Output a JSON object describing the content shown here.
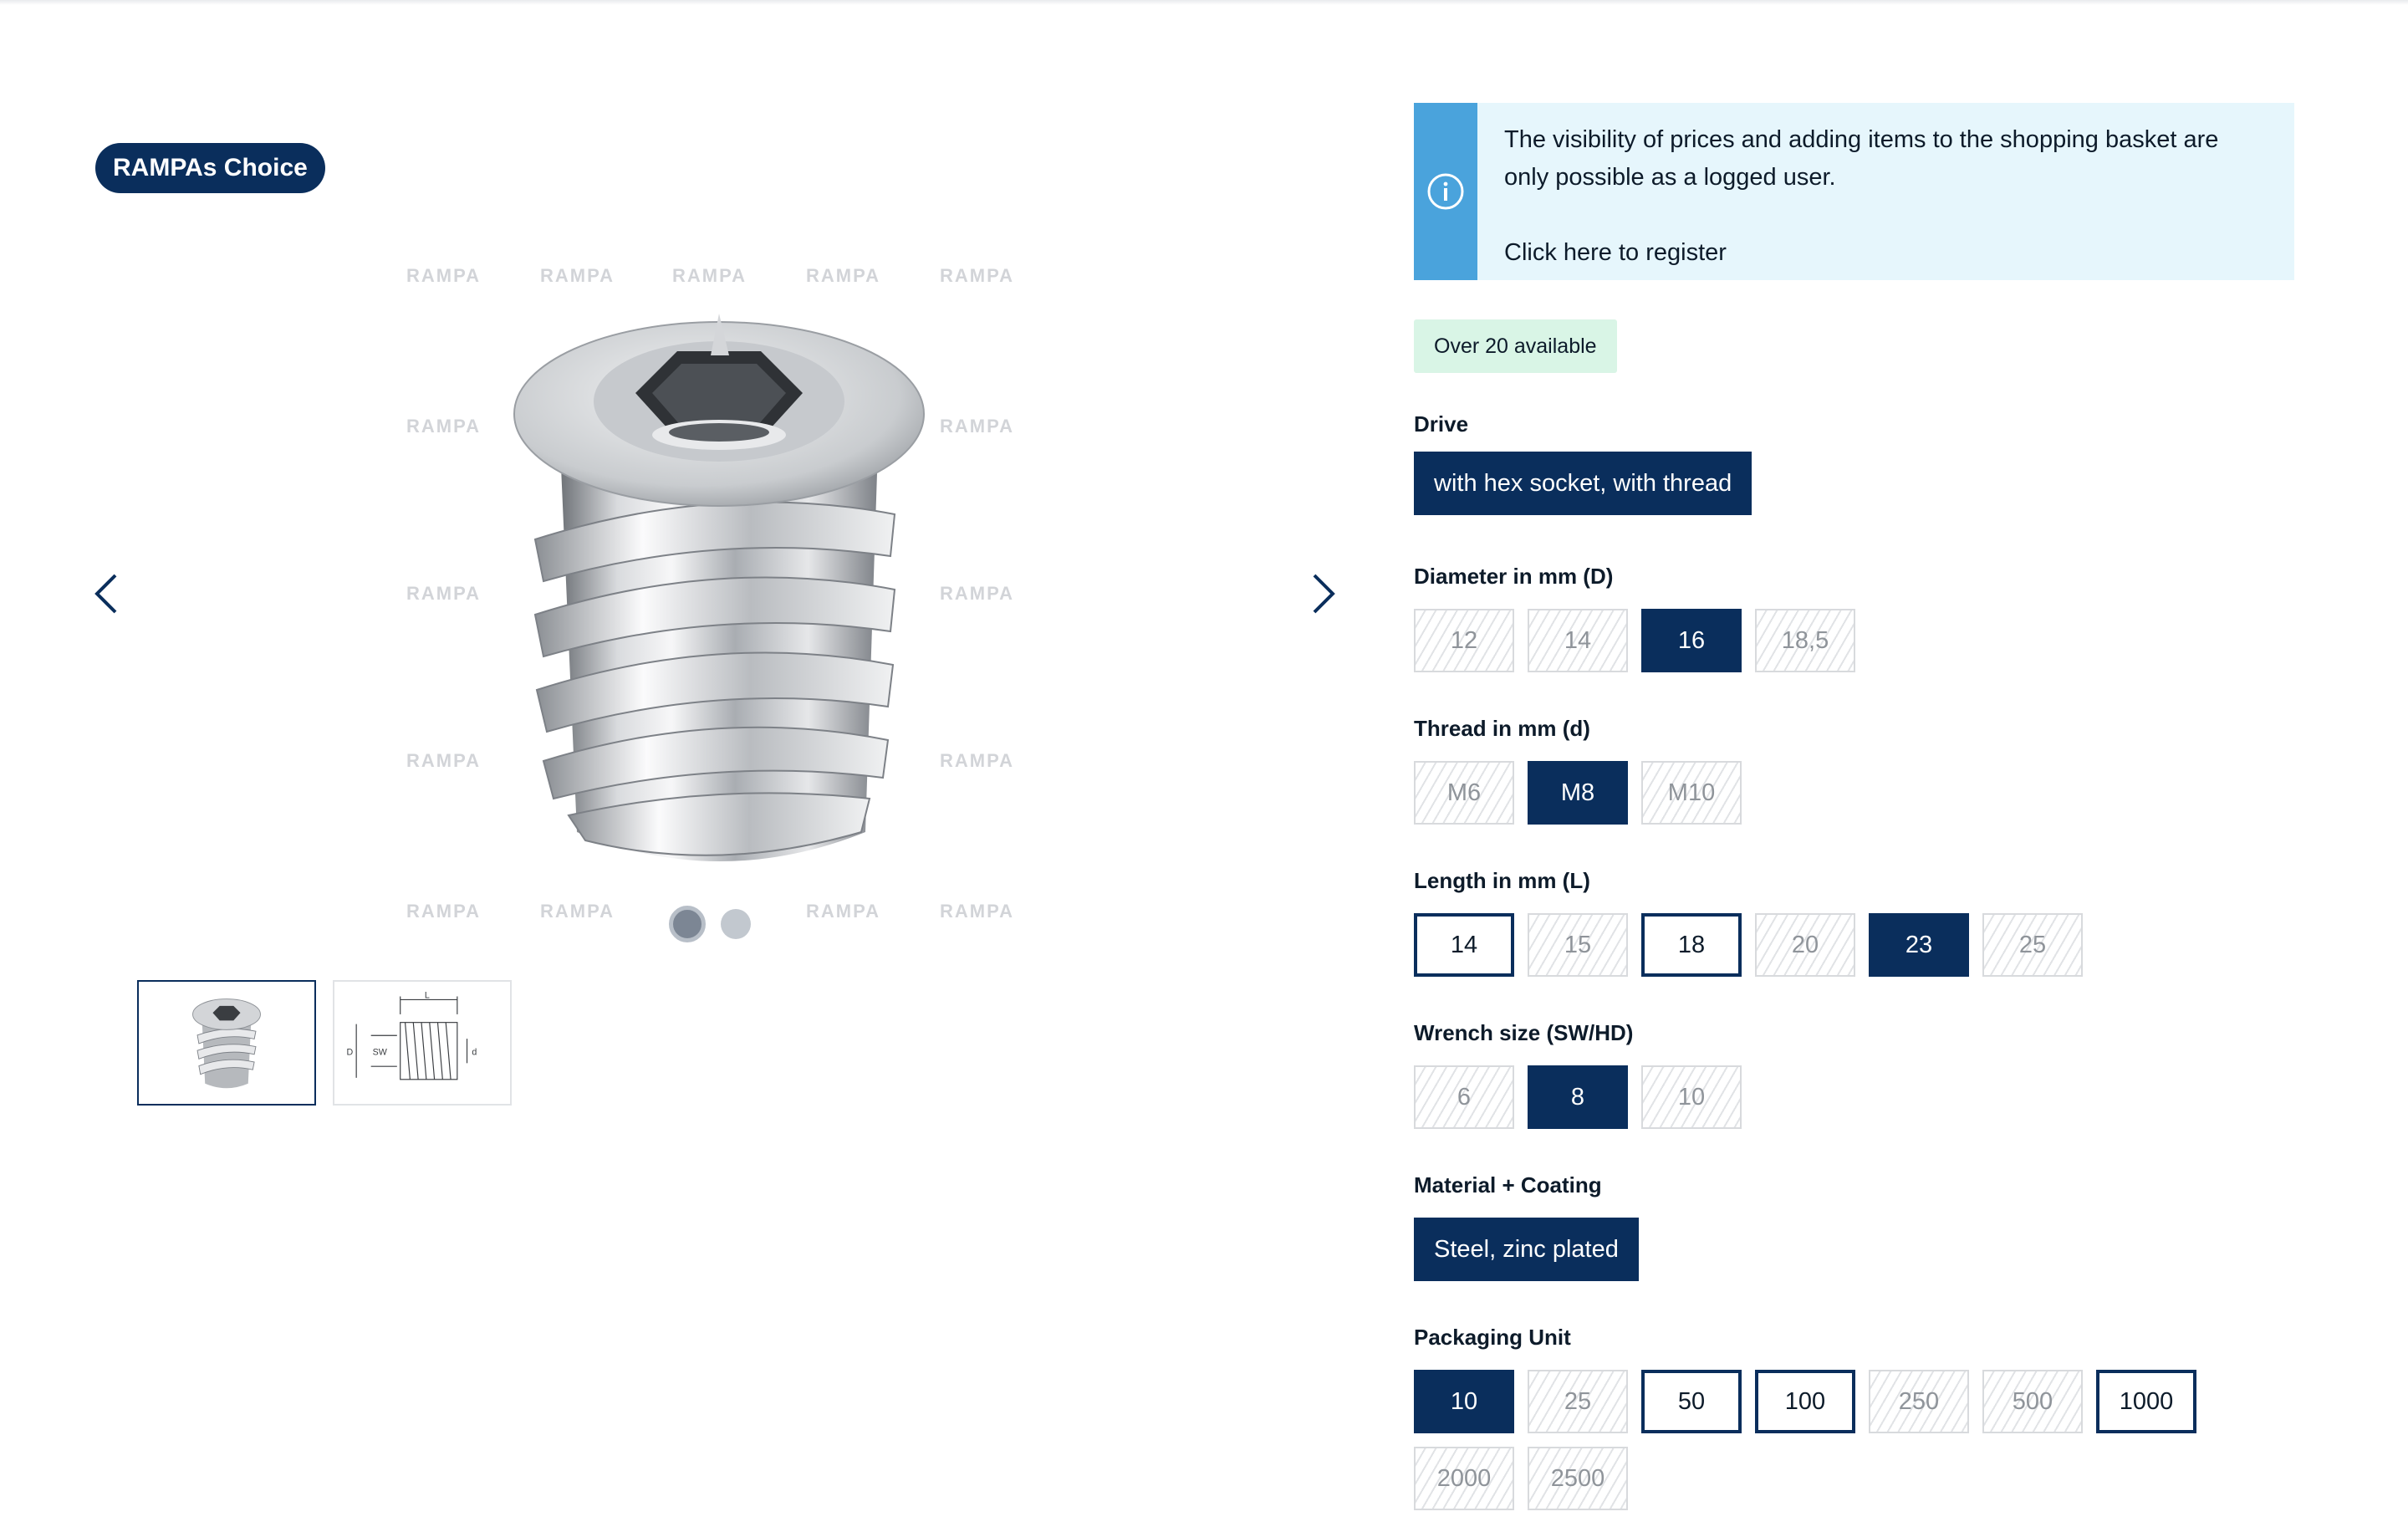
{
  "badge": "RAMPAs Choice",
  "watermark": "RAMPA",
  "notice": {
    "text": "The visibility of prices and adding items to the shopping basket are only possible as a logged user.",
    "link": "Click here to register"
  },
  "stock": "Over 20 available",
  "drive": {
    "label": "Drive",
    "value": "with hex socket, with thread"
  },
  "diameter": {
    "label": "Diameter in mm (D)",
    "options": [
      "12",
      "14",
      "16",
      "18,5"
    ]
  },
  "thread": {
    "label": "Thread in mm (d)",
    "options": [
      "M6",
      "M8",
      "M10"
    ]
  },
  "length": {
    "label": "Length in mm (L)",
    "options": [
      "14",
      "15",
      "18",
      "20",
      "23",
      "25"
    ]
  },
  "wrench": {
    "label": "Wrench size (SW/HD)",
    "options": [
      "6",
      "8",
      "10"
    ]
  },
  "material": {
    "label": "Material + Coating",
    "value": "Steel, zinc plated"
  },
  "packaging": {
    "label": "Packaging Unit",
    "options": [
      "10",
      "25",
      "50",
      "100",
      "250",
      "500",
      "1000",
      "2000",
      "2500"
    ]
  },
  "drawing": {
    "sw": "SW",
    "d_upper": "D",
    "d_lower": "d",
    "l": "L"
  },
  "icons": {
    "info": "info-icon",
    "prev": "chevron-left-icon",
    "next": "chevron-right-icon"
  },
  "colors": {
    "primary": "#0a2e5c",
    "info_bar": "#4aa3dc",
    "info_bg": "#e6f6fc",
    "stock_bg": "#d9f5e6"
  }
}
